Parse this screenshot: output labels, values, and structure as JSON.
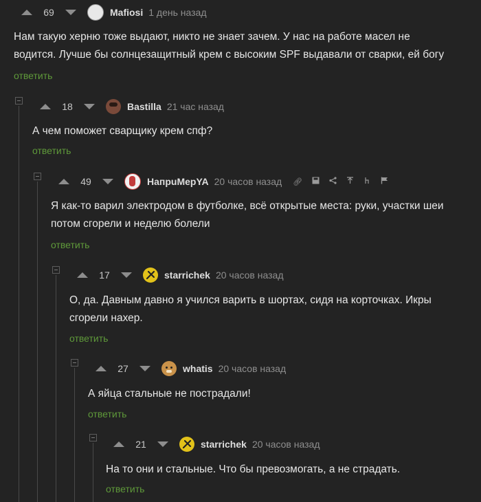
{
  "reply_label": "ответить",
  "comments": [
    {
      "rating": "69",
      "author": "Mafiosi",
      "time": "1 день назад",
      "avatar_color": "#e8e8e8",
      "lines": [
        "Нам такую херню тоже выдают, никто не знает зачем. У нас на работе масел не",
        "водится. Лучше бы солнцезащитный крем с высоким SPF выдавали от сварки, ей богу"
      ]
    },
    {
      "rating": "18",
      "author": "Bastilla",
      "time": "21 час назад",
      "avatar_color": "#7a4a3a",
      "lines": [
        "А чем поможет сварщику крем спф?"
      ]
    },
    {
      "rating": "49",
      "author": "НапрuМерYA",
      "time": "20 часов назад",
      "avatar_color": "#c23b3b",
      "tools": [
        "link-icon",
        "save-icon",
        "share-icon",
        "pin-icon",
        "cursor-icon",
        "flag-icon"
      ],
      "lines": [
        "Я как-то варил электродом в футболке, всё открытые места: руки, участки шеи",
        "потом сгорели и неделю болели"
      ]
    },
    {
      "rating": "17",
      "author": "starrichek",
      "time": "20 часов назад",
      "avatar_color": "#e2c21a",
      "lines": [
        "О, да. Давным давно я учился варить в шортах, сидя на корточках. Икры",
        "сгорели нахер."
      ]
    },
    {
      "rating": "27",
      "author": "whatis",
      "time": "20 часов назад",
      "avatar_color": "#c9924a",
      "lines": [
        "А яйца стальные не пострадали!"
      ]
    },
    {
      "rating": "21",
      "author": "starrichek",
      "time": "20 часов назад",
      "avatar_color": "#e2c21a",
      "lines": [
        "На то они и стальные. Что бы превозмогать, а не страдать."
      ]
    }
  ]
}
